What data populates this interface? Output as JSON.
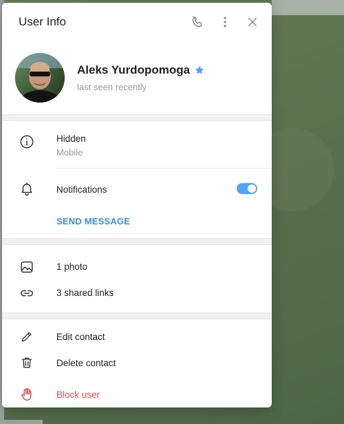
{
  "window": {
    "title": "User Info"
  },
  "header": {
    "icons": [
      "phone-icon",
      "more-vertical-icon",
      "close-icon"
    ]
  },
  "profile": {
    "name": "Aleks Yurdopomoga",
    "status": "last seen recently",
    "badge_icon": "star-icon",
    "accent": "#4ea4f6"
  },
  "info": {
    "phone_value": "Hidden",
    "phone_label": "Mobile",
    "notifications_label": "Notifications",
    "notifications_on": true,
    "send_message_label": "SEND MESSAGE"
  },
  "media": {
    "photos_label": "1 photo",
    "links_label": "3 shared links"
  },
  "actions": {
    "edit_label": "Edit contact",
    "delete_label": "Delete contact",
    "block_label": "Block user",
    "danger_color": "#d14e4e"
  },
  "colors": {
    "link": "#3a8fd0",
    "secondary_text": "#999999",
    "toggle": "#4ea4f6"
  }
}
